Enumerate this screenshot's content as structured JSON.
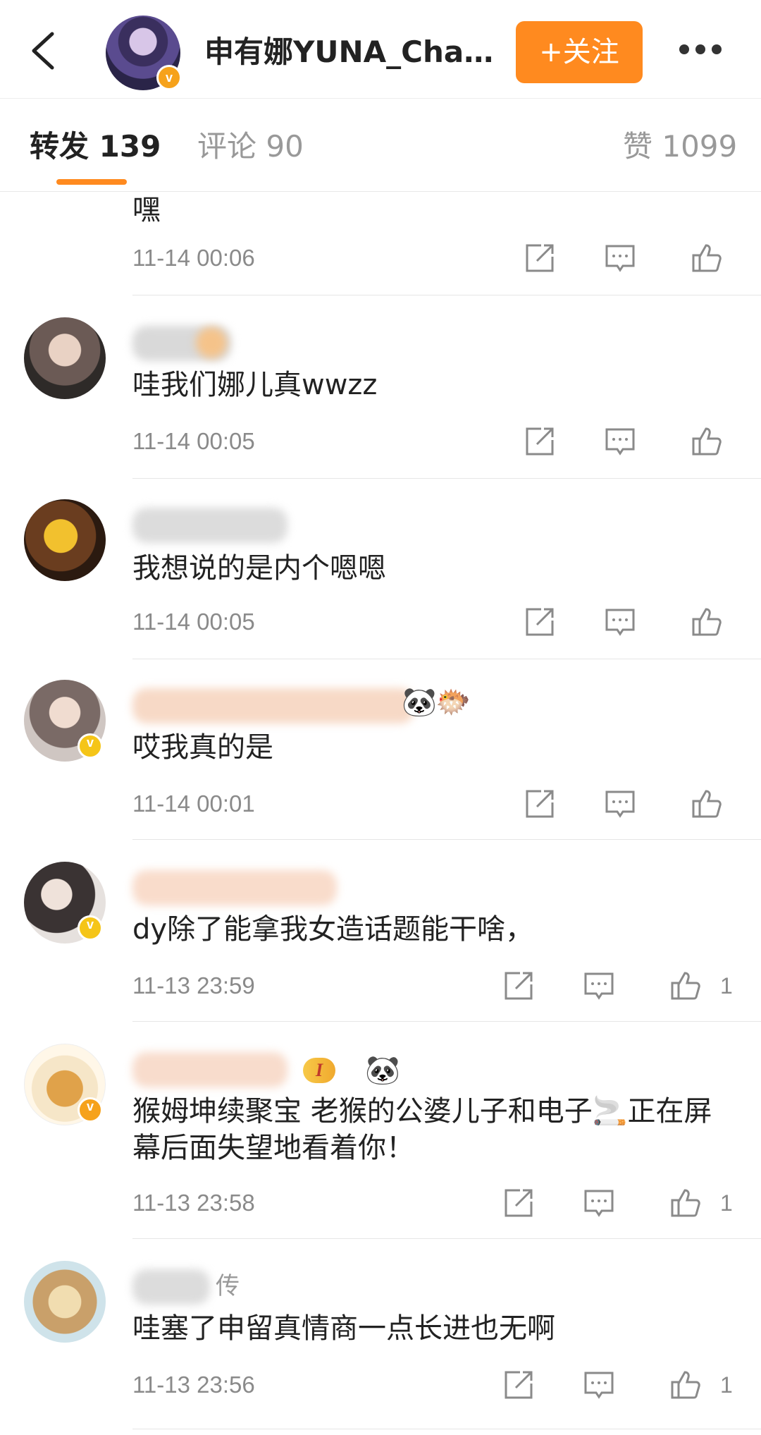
{
  "header": {
    "title": "申有娜YUNA_Chan...",
    "follow_label": "+关注"
  },
  "tabs": [
    {
      "label": "转发 139"
    },
    {
      "label": "评论 90"
    },
    {
      "label": "赞 1099"
    }
  ],
  "comments": [
    {
      "text": "嘿",
      "time": "11-14 00:06",
      "likes": ""
    },
    {
      "text": "哇我们娜儿真wwzz",
      "time": "11-14 00:05",
      "likes": ""
    },
    {
      "text": "我想说的是内个嗯嗯",
      "time": "11-14 00:05",
      "likes": ""
    },
    {
      "text": "哎我真的是",
      "time": "11-14 00:01",
      "likes": ""
    },
    {
      "text": "dy除了能拿我女造话题能干啥，",
      "time": "11-13 23:59",
      "likes": "1"
    },
    {
      "text": "猴姆坤续聚宝 老猴的公婆儿子和电子🚬正在屏幕后面失望地看着你！",
      "time": "11-13 23:58",
      "likes": "1"
    },
    {
      "text": "哇塞了申留真情商一点长进也无啊",
      "time": "11-13 23:56",
      "likes": "1"
    }
  ],
  "badges": {
    "level_badge": "I",
    "name_suffix_7": "传",
    "verified_mark": "v"
  },
  "colors": {
    "accent": "#ff8a1f",
    "verified_yellow": "#f5c518",
    "verified_orange": "#f6a21b"
  }
}
